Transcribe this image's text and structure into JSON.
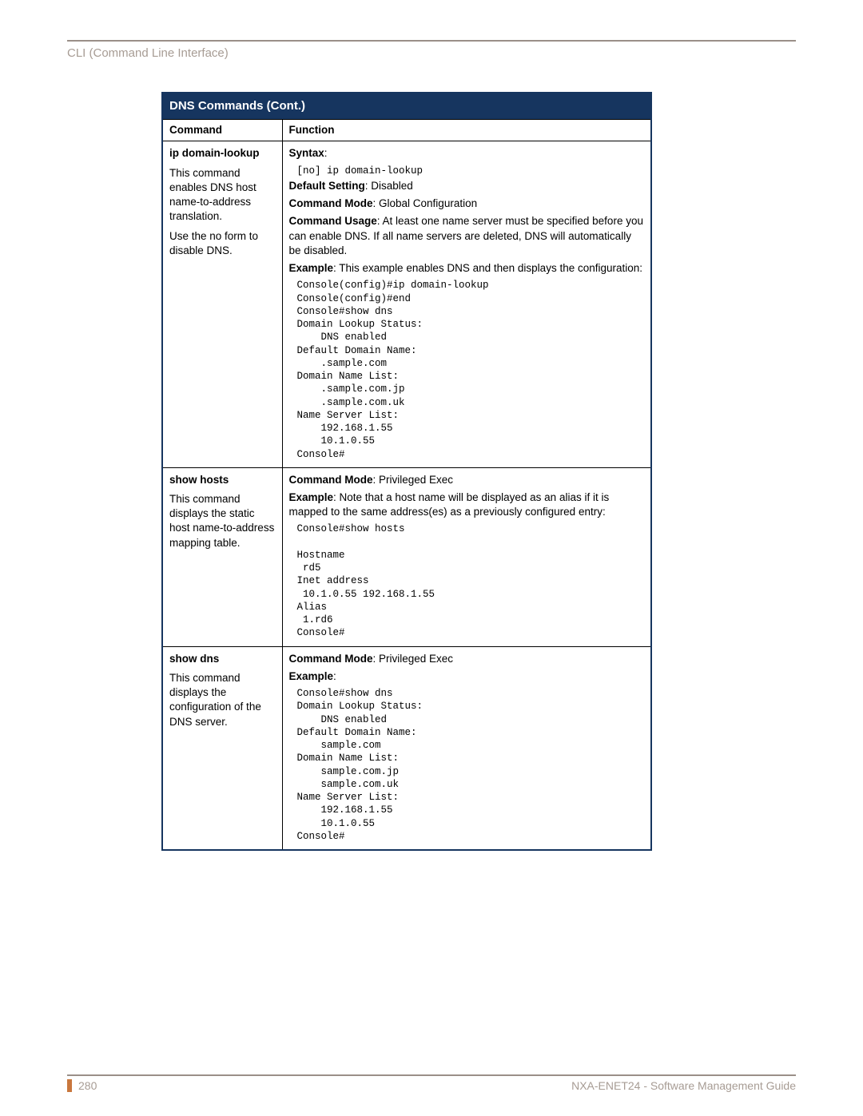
{
  "breadcrumb": "CLI (Command Line Interface)",
  "table_title": "DNS Commands (Cont.)",
  "col_command": "Command",
  "col_function": "Function",
  "rows": [
    {
      "name": "ip domain-lookup",
      "desc1": "This command enables DNS host name-to-address translation.",
      "desc2": "Use the no form to disable DNS.",
      "syntax_label": "Syntax",
      "syntax_code": "[no] ip domain-lookup",
      "default_label": "Default Setting",
      "default_val": ": Disabled",
      "mode_label": "Command Mode",
      "mode_val": ": Global Configuration",
      "usage_label": "Command Usage",
      "usage_val": ": At least one name server must be specified before you can enable DNS. If all name servers are deleted, DNS will automatically be disabled.",
      "example_label": "Example",
      "example_val": ": This example enables DNS and then displays the configuration:",
      "example_code": "Console(config)#ip domain-lookup\nConsole(config)#end\nConsole#show dns\nDomain Lookup Status:\n    DNS enabled\nDefault Domain Name:\n    .sample.com\nDomain Name List:\n    .sample.com.jp\n    .sample.com.uk\nName Server List:\n    192.168.1.55\n    10.1.0.55\nConsole#"
    },
    {
      "name": "show hosts",
      "desc1": "This command displays the static host name-to-address mapping table.",
      "mode_label": "Command Mode",
      "mode_val": ": Privileged Exec",
      "example_label": "Example",
      "example_val": ": Note that a host name will be displayed as an alias if it is mapped to the same address(es) as a previously configured entry:",
      "example_code": "Console#show hosts\n\nHostname\n rd5\nInet address\n 10.1.0.55 192.168.1.55\nAlias\n 1.rd6\nConsole#"
    },
    {
      "name": "show dns",
      "desc1": "This command displays the configuration of the DNS server.",
      "mode_label": "Command Mode",
      "mode_val": ": Privileged Exec",
      "example_label": "Example",
      "example_val": ":",
      "example_code": "Console#show dns\nDomain Lookup Status:\n    DNS enabled\nDefault Domain Name:\n    sample.com\nDomain Name List:\n    sample.com.jp\n    sample.com.uk\nName Server List:\n    192.168.1.55\n    10.1.0.55\nConsole#"
    }
  ],
  "footer": {
    "page": "280",
    "doc": "NXA-ENET24 - Software Management Guide"
  }
}
